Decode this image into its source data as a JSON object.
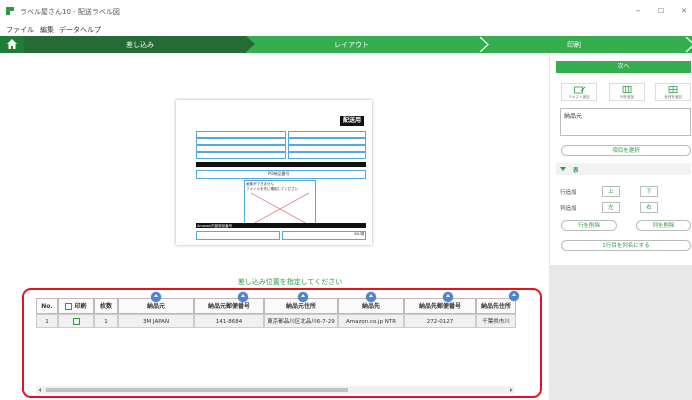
{
  "window": {
    "title": "ラベル屋さん10 - 配送ラベル図",
    "min": "–",
    "max": "☐",
    "close": "✕"
  },
  "menu": [
    "ファイル",
    "編集",
    "データ",
    "ヘルプ"
  ],
  "steps": [
    "差し込み",
    "レイアウト",
    "印刷"
  ],
  "preview": {
    "stamp": "配送用",
    "po_label": "PO納品番号",
    "image_text_1": "画像ができません",
    "image_text_2": "ファイルを先に確認してください",
    "bar_label": "Amazon内部部品番号",
    "sku_label": "SKU数"
  },
  "instruction": "差し込み位置を指定してください",
  "table": {
    "headers": [
      "No.",
      "印刷",
      "枚数",
      "納品元",
      "納品元郵便番号",
      "納品元住所",
      "納品先",
      "納品先郵便番号",
      "納品先住所"
    ],
    "rows": [
      [
        "1",
        "",
        "1",
        "3M JAPAN",
        "141-8684",
        "東京都品川区北品川6-7-29",
        "Amazon.co.jp NTR",
        "272-0127",
        "千葉県市川"
      ]
    ]
  },
  "right_panel": {
    "next_label": "次へ",
    "tools": [
      "テキスト追加",
      "列を追加",
      "全列を追加"
    ],
    "field_value": "納品元",
    "choose_label": "項目を選択",
    "section_label": "表",
    "row_add_label": "行追加",
    "row_add_up": "上",
    "row_add_down": "下",
    "col_add_label": "列追加",
    "col_add_left": "左",
    "col_add_right": "右",
    "delete_row": "行を削除",
    "delete_col": "列を削除",
    "row_to_col": "1行目を列名にする"
  },
  "colors": {
    "accent_green": "#36ad4f",
    "dark_green": "#256b35",
    "highlight_red": "#e0141c"
  }
}
